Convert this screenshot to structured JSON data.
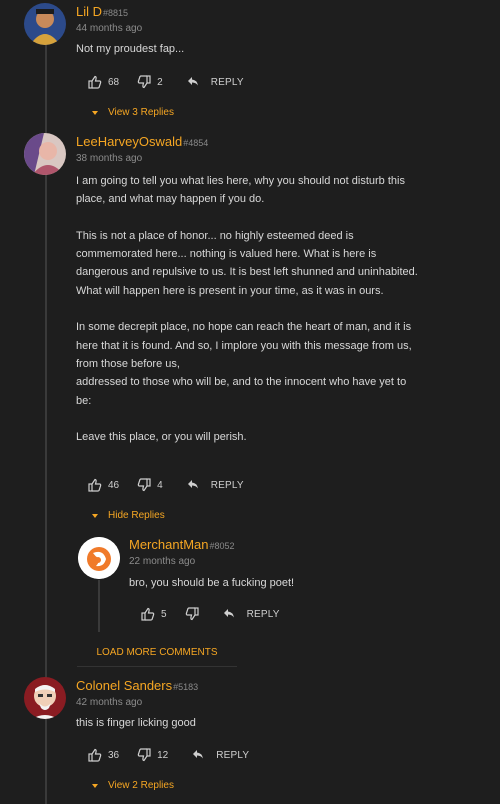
{
  "comments": [
    {
      "username": "Lil D",
      "user_id": "#8815",
      "time": "44 months ago",
      "body": [
        "Not my proudest fap..."
      ],
      "likes": "68",
      "dislikes": "2",
      "reply_label": "REPLY",
      "toggle_label": "View 3 Replies"
    },
    {
      "username": "LeeHarveyOswald",
      "user_id": "#4854",
      "time": "38 months ago",
      "body": [
        "I am going to tell you what lies here, why you should not disturb this place, and what may happen if you do.",
        "This is not a place of honor... no highly esteemed deed is commemorated here... nothing is valued here. What is here is dangerous and repulsive to us. It is best left shunned and uninhabited. What will happen here is present in your time, as it was in ours.",
        "In some decrepit place, no hope can reach the heart of man, and it is here that it is found. And so, I implore you with this message from us, from those before us,\naddressed to those who will be, and to the innocent who have yet to be:",
        "Leave this place, or you will perish."
      ],
      "likes": "46",
      "dislikes": "4",
      "reply_label": "REPLY",
      "toggle_label": "Hide Replies",
      "replies": [
        {
          "username": "MerchantMan",
          "user_id": "#8052",
          "time": "22 months ago",
          "body": [
            "bro, you should be a fucking poet!"
          ],
          "likes": "5",
          "dislikes": "",
          "reply_label": "REPLY"
        }
      ],
      "load_more_label": "LOAD MORE COMMENTS"
    },
    {
      "username": "Colonel Sanders",
      "user_id": "#5183",
      "time": "42 months ago",
      "body": [
        "this is finger licking good"
      ],
      "likes": "36",
      "dislikes": "12",
      "reply_label": "REPLY",
      "toggle_label": "View 2 Replies"
    }
  ],
  "colors": {
    "background": "#1e1e1e",
    "accent": "#f5a623",
    "text": "#d8d8d8",
    "muted": "#8c8c8c"
  },
  "icons": [
    "thumbs-up-icon",
    "thumbs-down-icon",
    "reply-arrow-icon",
    "caret-down-icon"
  ]
}
